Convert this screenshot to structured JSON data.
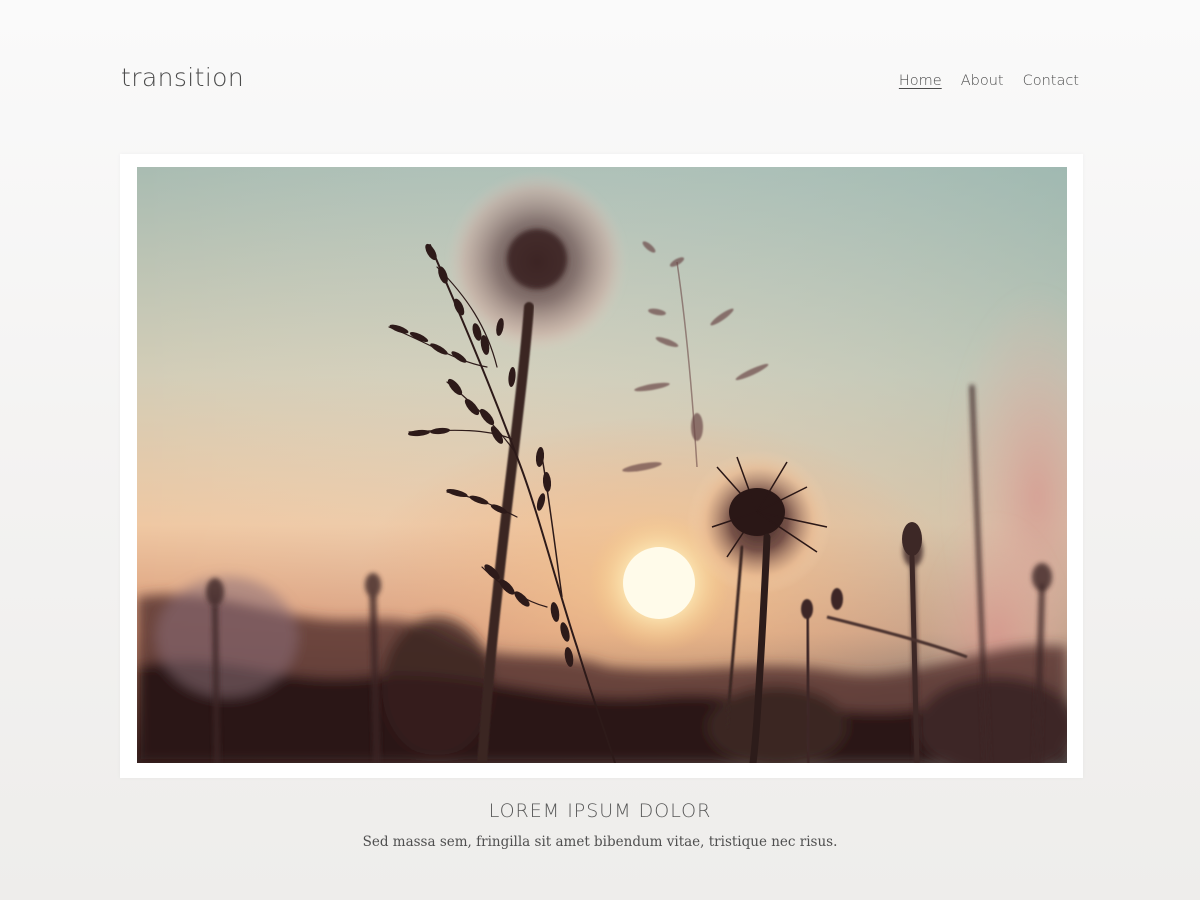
{
  "site": {
    "logo": "transition"
  },
  "nav": {
    "items": [
      {
        "label": "Home",
        "active": true
      },
      {
        "label": "About",
        "active": false
      },
      {
        "label": "Contact",
        "active": false
      }
    ]
  },
  "hero": {
    "image_icon": "dandelion-sunset-photo"
  },
  "caption": {
    "title": "LOREM IPSUM DOLOR",
    "text": "Sed massa sem, fringilla sit amet bibendum vitae, tristique nec risus."
  },
  "colors": {
    "background": "#f4f3f2",
    "text": "#4b4b4b",
    "frame": "#ffffff"
  }
}
